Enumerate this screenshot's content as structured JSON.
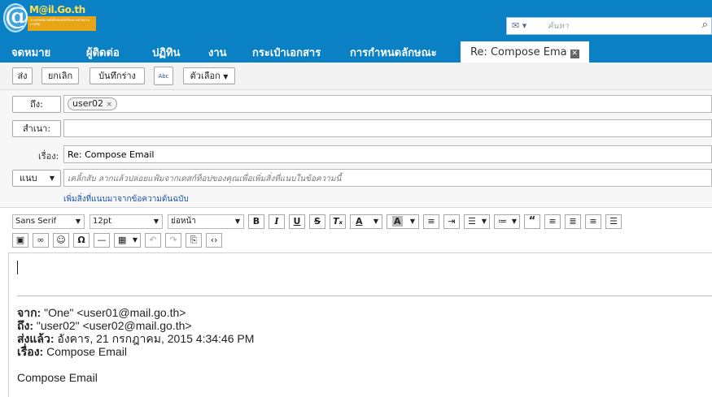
{
  "brand": {
    "logo_text": "M@il.Go.th",
    "tagline": "ระบบจดหมายอิเล็กทรอนิกส์ของ หน่วยงานภาครัฐ"
  },
  "search": {
    "type_label": "✉ ▾",
    "placeholder": "ค้นหา",
    "button": "🔍"
  },
  "tabs": [
    "จดหมาย",
    "ผู้ติดต่อ",
    "ปฏิทิน",
    "งาน",
    "กระเป๋าเอกสาร",
    "การกำหนดลักษณะ"
  ],
  "active_tab": {
    "label": "Re: Compose Ema",
    "close": "✕"
  },
  "toolbar": {
    "send": "ส่ง",
    "cancel": "ยกเลิก",
    "save_draft": "บันทึกร่าง",
    "spell": "Abc",
    "options": "ตัวเลือก"
  },
  "form": {
    "to_label": "ถึง:",
    "to_recipients": [
      {
        "name": "user02",
        "remove": "×"
      }
    ],
    "cc_label": "สำเนา:",
    "subject_label": "เรื่อง:",
    "subject_value": "Re: Compose Email",
    "attach_label": "แนบ",
    "attach_hint": "เคลิ้กสับ ลากแล้วปล่อยแฟ้มจากเดสก์ท็อปของคุณเพื่อเพิ่มสิ่งที่แนบในข้อความนี้",
    "add_original_attachments": "เพิ่มสิ่งที่แนบมาจากข้อความต้นฉบับ"
  },
  "editor_toolbar": {
    "font_family": "Sans Serif",
    "font_size": "12pt",
    "paragraph": "ย่อหน้า",
    "row1_icons": [
      "bold-icon",
      "italic-icon",
      "underline-icon",
      "strikethrough-icon",
      "clear-format-icon",
      "font-color-icon",
      "highlight-icon",
      "align-left-icon",
      "indent-icon",
      "bullet-list-icon",
      "number-list-icon",
      "blockquote-icon",
      "justify-left-icon",
      "center-icon",
      "justify-right-icon",
      "justify-full-icon"
    ],
    "row2_icons": [
      "image-icon",
      "link-icon",
      "emoji-icon",
      "special-char-icon",
      "horizontal-rule-icon",
      "table-icon",
      "undo-icon",
      "redo-icon",
      "paste-icon",
      "code-icon"
    ]
  },
  "quoted": {
    "from_label": "จาก:",
    "from_value": "\"One\" <user01@mail.go.th>",
    "to_label": "ถึง:",
    "to_value": "\"user02\" <user02@mail.go.th>",
    "sent_label": "ส่งแล้ว:",
    "sent_value": "อังคาร, 21 กรกฎาคม, 2015 4:34:46 PM",
    "subject_label": "เรื่อง:",
    "subject_value": "Compose Email",
    "body": "Compose Email"
  },
  "colors": {
    "header_blue": "#0a80c5",
    "logo_orange": "#e6a417",
    "link_blue": "#1a55a8"
  }
}
